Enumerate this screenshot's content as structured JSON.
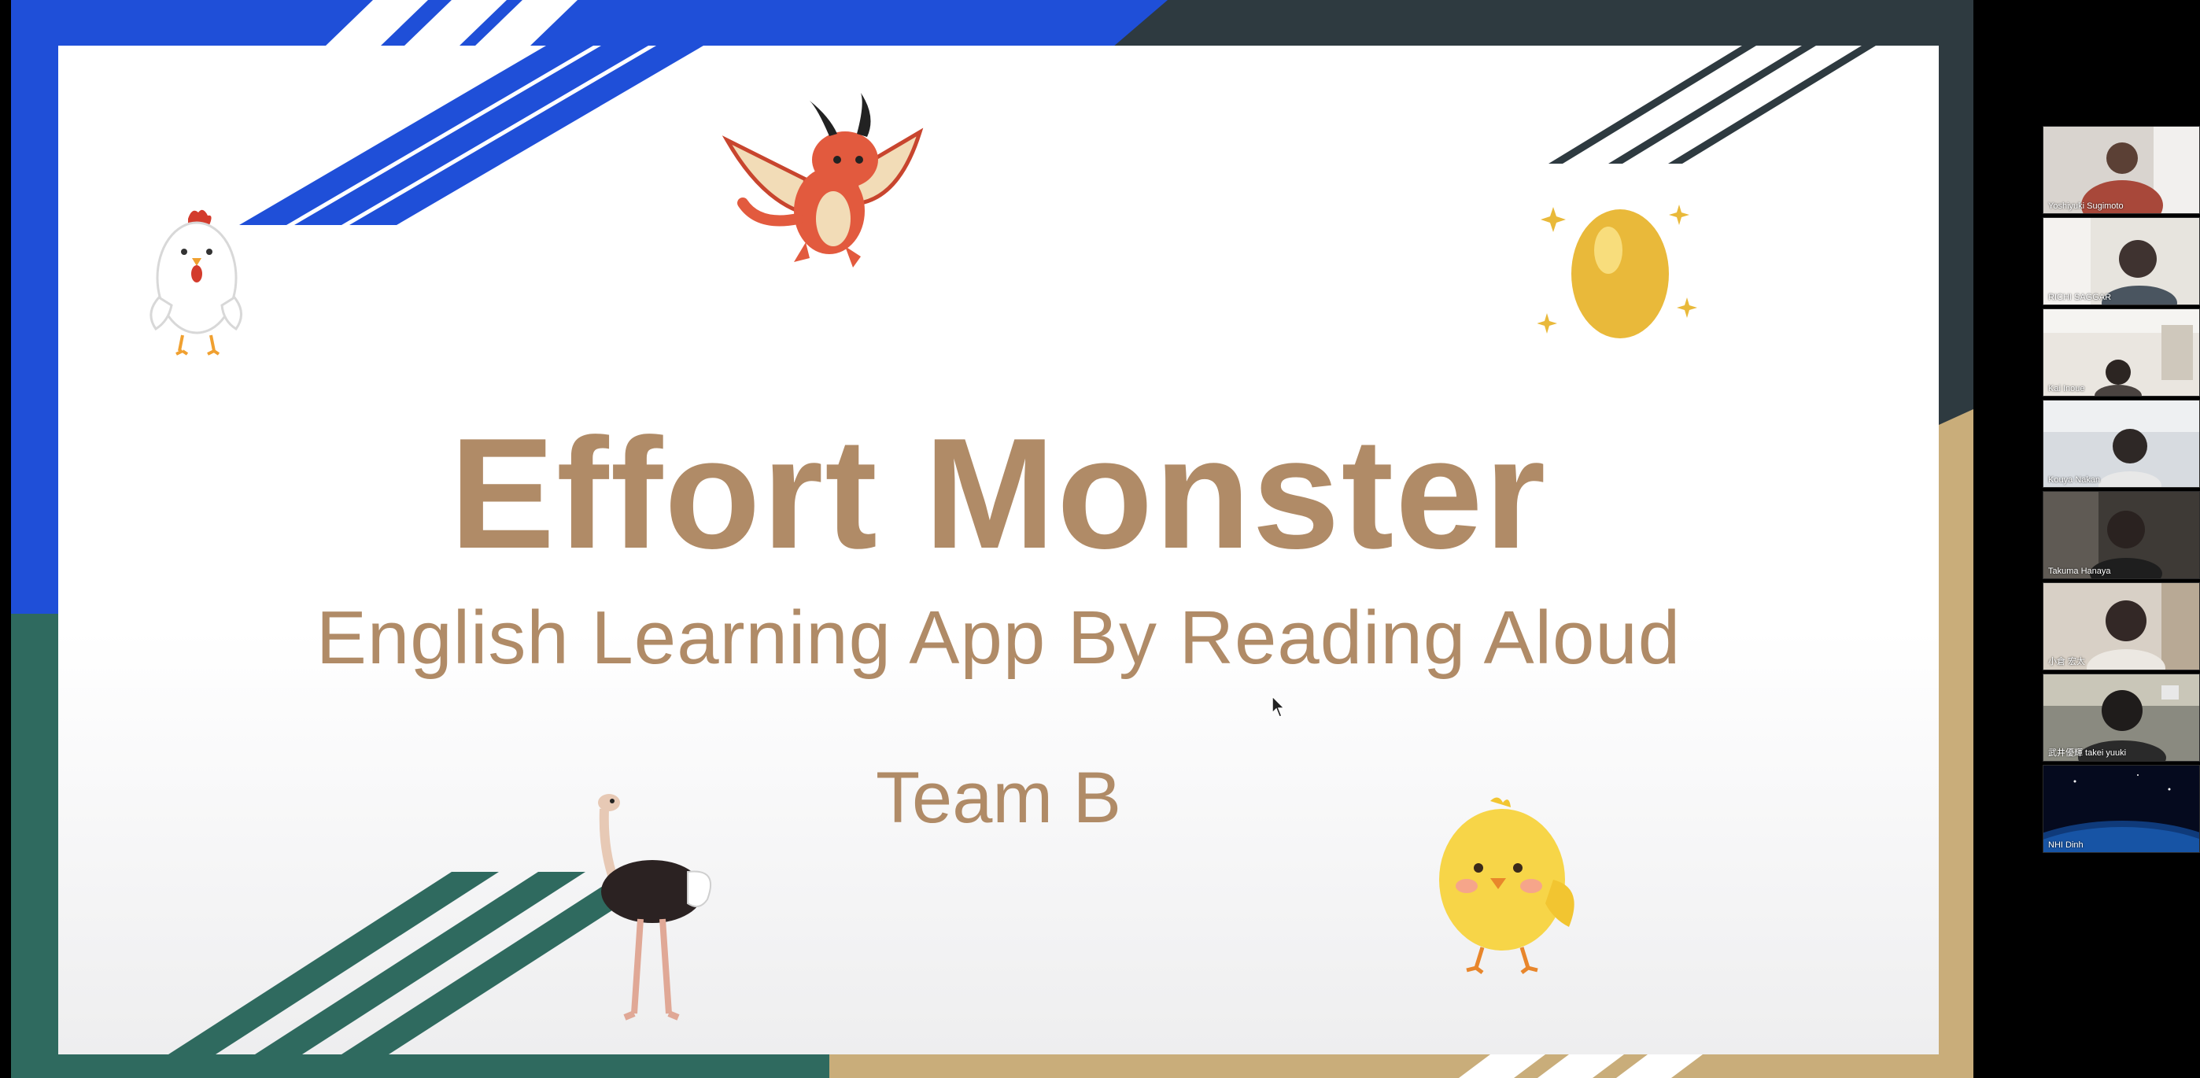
{
  "slide": {
    "title": "Effort Monster",
    "subtitle": "English Learning App By Reading Aloud",
    "team": "Team B",
    "colors": {
      "title": "#b08b67",
      "blue_accent": "#1f4fd8",
      "teal_accent": "#2f6a5f",
      "dark_accent": "#2e3a40",
      "gold_accent": "#c9ad7a"
    },
    "mascots": [
      "chicken-icon",
      "dragon-icon",
      "egg-icon",
      "ostrich-icon",
      "chick-icon"
    ]
  },
  "participants": [
    {
      "name": "Yoshiyuki Sugimoto"
    },
    {
      "name": "RICHI SAGGAR"
    },
    {
      "name": "Kai Inoue"
    },
    {
      "name": "Kouya Nakan"
    },
    {
      "name": "Takuma Hanaya"
    },
    {
      "name": "小倉 宏太"
    },
    {
      "name": "武井優輝 takei yuuki"
    },
    {
      "name": "NHI Dinh"
    }
  ]
}
